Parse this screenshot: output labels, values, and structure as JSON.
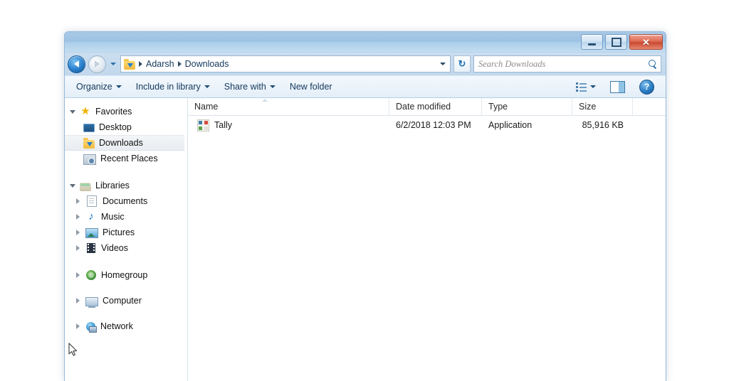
{
  "window": {
    "title": "",
    "controls": {
      "minimize": "minimize-button",
      "maximize": "maximize-button",
      "close": "✕"
    }
  },
  "address_bar": {
    "back_tooltip": "Back",
    "forward_tooltip": "Forward",
    "breadcrumbs": [
      "Adarsh",
      "Downloads"
    ],
    "folder_icon": "downloads-folder-icon",
    "refresh_glyph": "↻",
    "history_dropdown": "recent-pages-dropdown"
  },
  "search": {
    "placeholder": "Search Downloads",
    "value": "",
    "icon": "search-icon"
  },
  "toolbar": {
    "items": [
      {
        "label": "Organize",
        "has_menu": true
      },
      {
        "label": "Include in library",
        "has_menu": true
      },
      {
        "label": "Share with",
        "has_menu": true
      },
      {
        "label": "New folder",
        "has_menu": false
      }
    ],
    "view_options": "change-view-icon",
    "view_dropdown": "view-dropdown-caret",
    "preview_pane": "preview-pane-icon",
    "help": "?"
  },
  "nav_pane": {
    "groups": [
      {
        "header": {
          "label": "Favorites",
          "icon": "star-icon",
          "expanded": true
        },
        "items": [
          {
            "label": "Desktop",
            "icon": "desktop-icon",
            "selected": false
          },
          {
            "label": "Downloads",
            "icon": "downloads-folder-icon",
            "selected": true
          },
          {
            "label": "Recent Places",
            "icon": "recent-places-icon",
            "selected": false
          }
        ]
      },
      {
        "header": {
          "label": "Libraries",
          "icon": "libraries-icon",
          "expanded": true
        },
        "items": [
          {
            "label": "Documents",
            "icon": "document-icon",
            "selected": false
          },
          {
            "label": "Music",
            "icon": "music-note-icon",
            "selected": false
          },
          {
            "label": "Pictures",
            "icon": "pictures-icon",
            "selected": false
          },
          {
            "label": "Videos",
            "icon": "videos-film-icon",
            "selected": false
          }
        ]
      },
      {
        "header": {
          "label": "Homegroup",
          "icon": "homegroup-icon",
          "expanded": false
        },
        "items": []
      },
      {
        "header": {
          "label": "Computer",
          "icon": "computer-icon",
          "expanded": false
        },
        "items": []
      },
      {
        "header": {
          "label": "Network",
          "icon": "network-icon",
          "expanded": false
        },
        "items": []
      }
    ]
  },
  "file_list": {
    "columns": [
      {
        "label": "Name",
        "sorted": "asc"
      },
      {
        "label": "Date modified",
        "sorted": null
      },
      {
        "label": "Type",
        "sorted": null
      },
      {
        "label": "Size",
        "sorted": null
      }
    ],
    "rows": [
      {
        "name": "Tally",
        "icon": "tally-application-icon",
        "date_modified": "6/2/2018 12:03 PM",
        "type": "Application",
        "size": "85,916 KB"
      }
    ]
  },
  "colors": {
    "frame": "#96b9d9",
    "titlebar": "#9dc2e3",
    "close_button": "#c94a32",
    "accent_blue": "#2f86d4",
    "selection": "#e9edf1"
  }
}
